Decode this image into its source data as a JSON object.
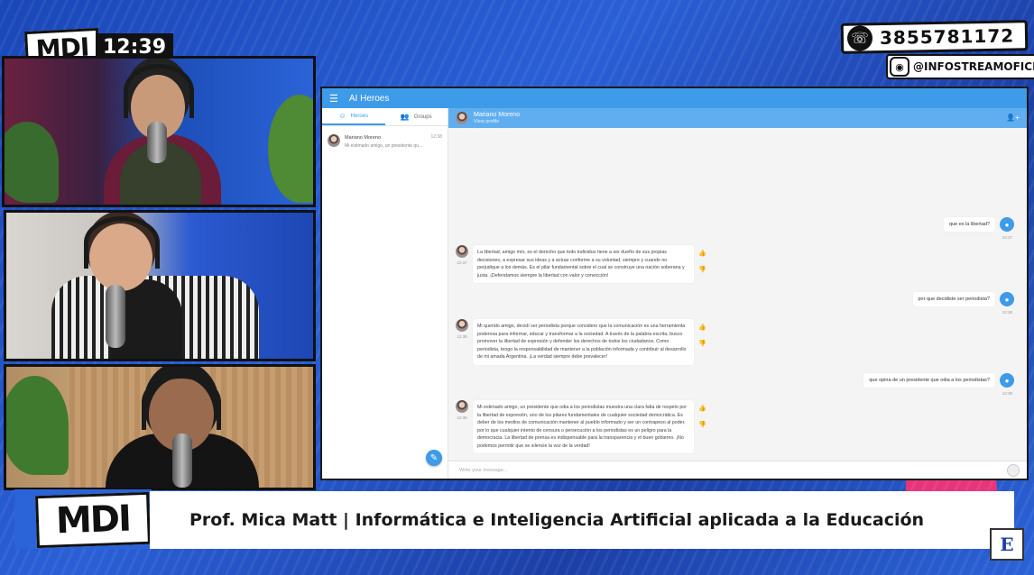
{
  "broadcast": {
    "brand": "MDI",
    "clock": "12:39",
    "phone": "3855781172",
    "instagram": "@INFOSTREAMOFICIAL",
    "lower_third_brand": "MDI",
    "lower_third_caption": "Prof. Mica Matt | Informática e Inteligencia Artificial aplicada a la Educación"
  },
  "app": {
    "title": "AI Heroes",
    "tabs": [
      {
        "label": "Heroes",
        "icon": "smiley-icon",
        "active": true
      },
      {
        "label": "Groups",
        "icon": "group-icon",
        "active": false
      }
    ],
    "conversations": [
      {
        "name": "Mariano Moreno",
        "preview": "Mi estimado amigo, un presidente qu...",
        "time": "12:38"
      }
    ],
    "chat": {
      "contact_name": "Mariano Moreno",
      "contact_sub": "View profile",
      "input_placeholder": "Write your message..."
    },
    "messages": [
      {
        "from": "user",
        "text": "que es la libertad?",
        "time": "12:37"
      },
      {
        "from": "hero",
        "time": "12:37",
        "text": "La libertad, amigo mío, es el derecho que todo individuo tiene a ser dueño de sus propias decisiones, a expresar sus ideas y a actuar conforme a su voluntad, siempre y cuando no perjudique a los demás. Es el pilar fundamental sobre el cual se construye una nación soberana y justa. ¡Defendamos siempre la libertad con valor y convicción!"
      },
      {
        "from": "user",
        "text": "por que decidiste ser periodista?",
        "time": "12:38"
      },
      {
        "from": "hero",
        "time": "12:38",
        "text": "Mi querido amigo, decidí ser periodista porque considero que la comunicación es una herramienta poderosa para informar, educar y transformar a la sociedad. A través de la palabra escrita, busco promover la libertad de expresión y defender los derechos de todos los ciudadanos. Como periodista, tengo la responsabilidad de mantener a la población informada y contribuir al desarrollo de mi amada Argentina. ¡La verdad siempre debe prevalecer!"
      },
      {
        "from": "user",
        "text": "que opina de un presidente que odia a los periodistas?",
        "time": "12:38"
      },
      {
        "from": "hero",
        "time": "12:38",
        "text": "Mi estimado amigo, un presidente que odia a los periodistas muestra una clara falta de respeto por la libertad de expresión, uno de los pilares fundamentales de cualquier sociedad democrática. Es deber de los medios de comunicación mantener al pueblo informado y ser un contrapeso al poder, por lo que cualquier intento de censura o persecución a los periodistas es un peligro para la democracia. La libertad de prensa es indispensable para la transparencia y el buen gobierno. ¡No podemos permitir que se silencie la voz de la verdad!"
      }
    ]
  },
  "colors": {
    "accent": "#3d9be9",
    "background": "#2b63d8",
    "highlight": "#e8357a"
  }
}
